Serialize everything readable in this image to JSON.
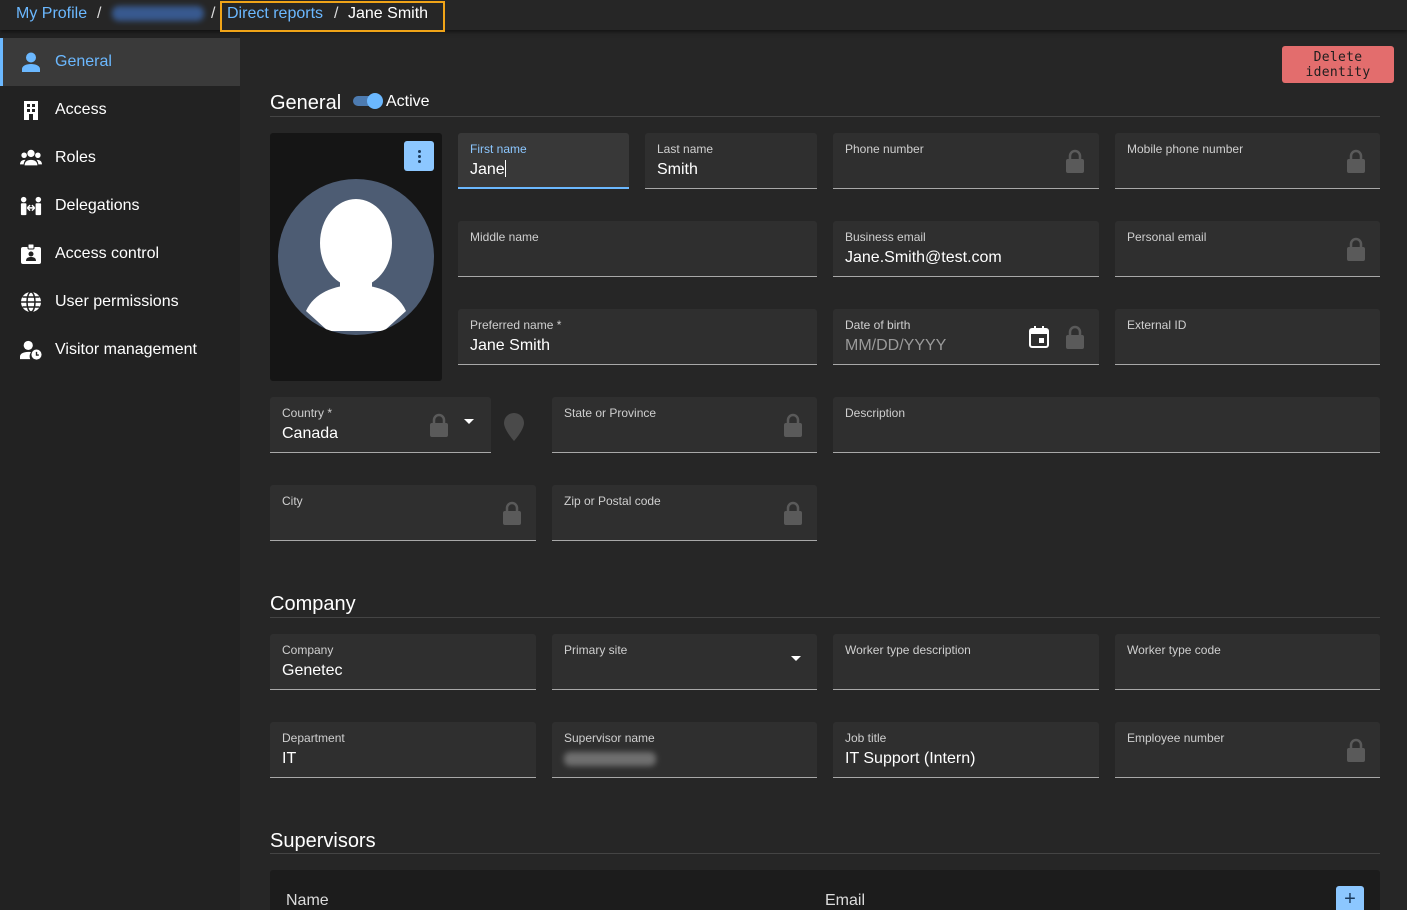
{
  "breadcrumb": {
    "my_profile": "My Profile",
    "sep1": "/",
    "sep2": "/",
    "direct_reports": "Direct reports",
    "sep3": "/",
    "current": "Jane Smith"
  },
  "sidebar": {
    "items": [
      {
        "label": "General",
        "icon": "person-icon",
        "active": true
      },
      {
        "label": "Access",
        "icon": "building-icon"
      },
      {
        "label": "Roles",
        "icon": "group-icon"
      },
      {
        "label": "Delegations",
        "icon": "delegation-icon"
      },
      {
        "label": "Access control",
        "icon": "badge-icon"
      },
      {
        "label": "User permissions",
        "icon": "globe-icon"
      },
      {
        "label": "Visitor management",
        "icon": "person-clock-icon"
      }
    ]
  },
  "actions": {
    "delete_identity": "Delete identity"
  },
  "general": {
    "title": "General",
    "active_label": "Active",
    "active": true,
    "fields": {
      "first_name": {
        "label": "First name",
        "value": "Jane"
      },
      "last_name": {
        "label": "Last name",
        "value": "Smith"
      },
      "phone": {
        "label": "Phone number",
        "value": ""
      },
      "mobile": {
        "label": "Mobile phone number",
        "value": ""
      },
      "middle_name": {
        "label": "Middle name",
        "value": ""
      },
      "business_email": {
        "label": "Business email",
        "value": "Jane.Smith@test.com"
      },
      "personal_email": {
        "label": "Personal email",
        "value": ""
      },
      "preferred_name": {
        "label": "Preferred name *",
        "value": "Jane Smith"
      },
      "dob": {
        "label": "Date of birth",
        "placeholder": "MM/DD/YYYY"
      },
      "external_id": {
        "label": "External ID",
        "value": ""
      },
      "country": {
        "label": "Country *",
        "value": "Canada"
      },
      "state": {
        "label": "State or Province",
        "value": ""
      },
      "description": {
        "label": "Description",
        "value": ""
      },
      "city": {
        "label": "City",
        "value": ""
      },
      "zip": {
        "label": "Zip or Postal code",
        "value": ""
      }
    }
  },
  "company": {
    "title": "Company",
    "fields": {
      "company": {
        "label": "Company",
        "value": "Genetec"
      },
      "primary_site": {
        "label": "Primary site",
        "value": ""
      },
      "worker_type_desc": {
        "label": "Worker type description",
        "value": ""
      },
      "worker_type_code": {
        "label": "Worker type code",
        "value": ""
      },
      "department": {
        "label": "Department",
        "value": "IT"
      },
      "supervisor_name": {
        "label": "Supervisor name"
      },
      "job_title": {
        "label": "Job title",
        "value": "IT Support (Intern)"
      },
      "employee_number": {
        "label": "Employee number",
        "value": ""
      }
    }
  },
  "supervisors": {
    "title": "Supervisors",
    "columns": {
      "name": "Name",
      "email": "Email"
    },
    "add_label": "+"
  },
  "colors": {
    "accent": "#6bb8ff",
    "danger": "#e36d6d",
    "highlight": "#f0a418"
  }
}
